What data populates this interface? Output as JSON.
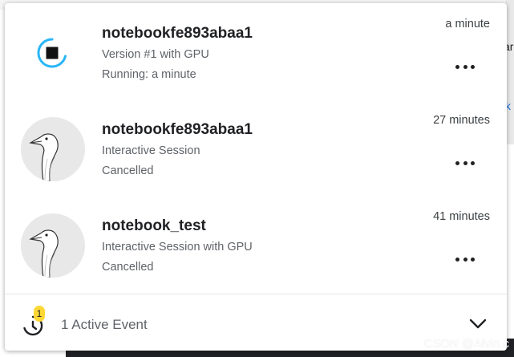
{
  "events": [
    {
      "title": "notebookfe893abaa1",
      "subtitle": "Version #1 with GPU",
      "status": "Running: a minute",
      "time": "a minute",
      "avatar": "running-spinner"
    },
    {
      "title": "notebookfe893abaa1",
      "subtitle": "Interactive Session",
      "status": "Cancelled",
      "time": "27 minutes",
      "avatar": "goose-avatar"
    },
    {
      "title": "notebook_test",
      "subtitle": "Interactive Session with GPU",
      "status": "Cancelled",
      "time": "41 minutes",
      "avatar": "goose-avatar"
    }
  ],
  "footer": {
    "badge_count": "1",
    "label": "1 Active Event",
    "icon": "history-icon",
    "toggle_icon": "chevron-down-icon"
  },
  "background": {
    "right_fragment_1": "ar",
    "right_fragment_2": "k"
  },
  "watermark": "CSDN @Alvin.c",
  "colors": {
    "spinner_accent": "#29b6f6",
    "badge": "#fdd835",
    "title": "#202124",
    "subtext": "#5f6368"
  }
}
